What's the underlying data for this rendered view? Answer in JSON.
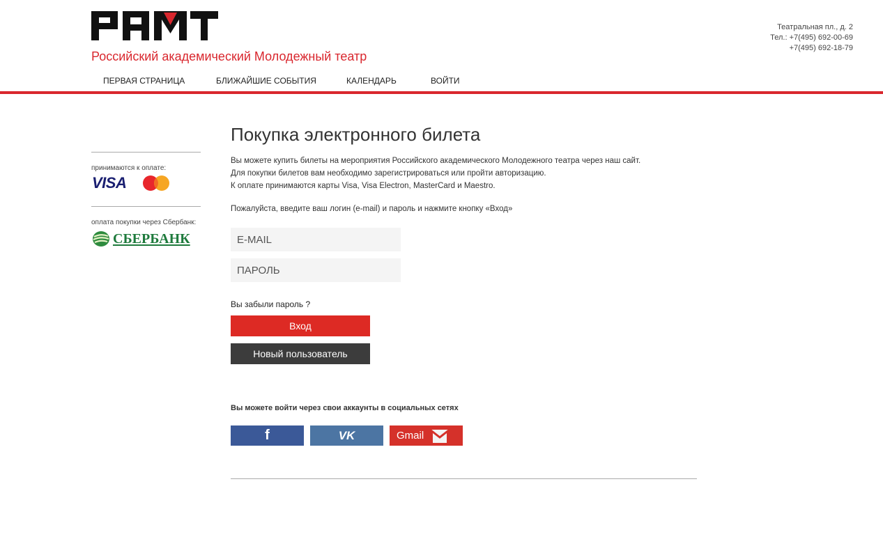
{
  "header": {
    "logo_text": "РАМТ",
    "subtitle": "Российский академический Молодежный театр",
    "contacts": {
      "address": "Театральная пл., д. 2",
      "phone1": "Тел.: +7(495) 692-00-69",
      "phone2": "+7(495) 692-18-79"
    }
  },
  "nav": {
    "items": [
      {
        "label": "ПЕРВАЯ СТРАНИЦА"
      },
      {
        "label": "БЛИЖАЙШИЕ СОБЫТИЯ"
      },
      {
        "label": "КАЛЕНДАРЬ"
      },
      {
        "label": "ВОЙТИ"
      }
    ]
  },
  "sidebar": {
    "payment_label": "принимаются к оплате:",
    "visa_label": "VISA",
    "mastercard_label": "MasterCard",
    "sber_label": "оплата покупки через Сбербанк:",
    "sber_logo_text": "СБЕРБАНК"
  },
  "main": {
    "title": "Покупка электронного билета",
    "intro": [
      "Вы можете купить билеты на мероприятия Российского академического Молодежного театра через наш сайт.",
      "Для покупки билетов вам необходимо зарегистрироваться или пройти авторизацию.",
      "К оплате принимаются карты Visa, Visa Electron, MasterCard и Maestro."
    ],
    "prompt": "Пожалуйста, введите ваш логин (e-mail) и пароль и нажмите кнопку «Вход»",
    "email_placeholder": "E-MAIL",
    "password_placeholder": "ПАРОЛЬ",
    "forgot": "Вы забыли пароль ?",
    "login_button": "Вход",
    "new_user_button": "Новый пользователь",
    "social_title": "Вы можете войти через свои аккаунты в социальных сетях",
    "social": {
      "facebook": "f",
      "vk": "VK",
      "gmail": "Gmail"
    }
  },
  "colors": {
    "accent": "#d9272e",
    "facebook": "#3b5998",
    "vk": "#4c75a3",
    "gmail": "#d5312a",
    "dark_button": "#3c3c3c"
  }
}
